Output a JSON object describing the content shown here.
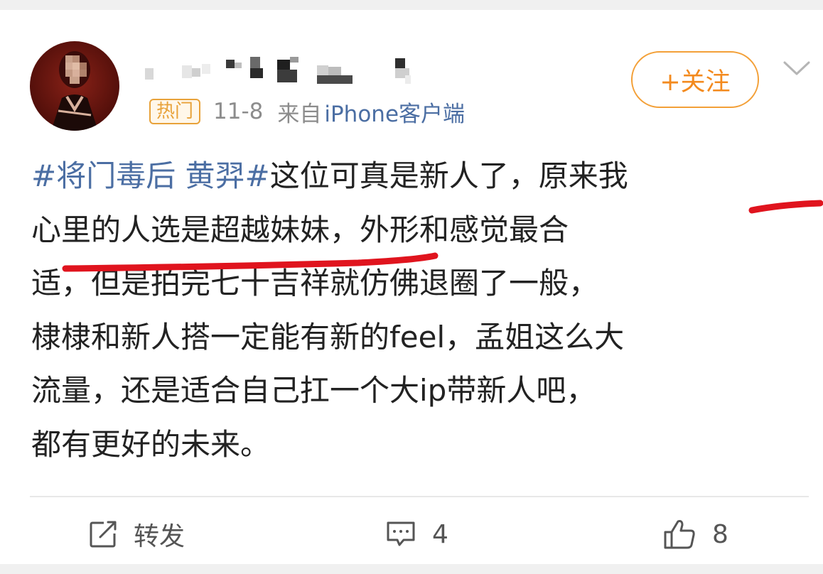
{
  "post": {
    "hot_badge": "热门",
    "date": "11-8",
    "source_prefix": "来自",
    "source": "iPhone客户端",
    "follow_label": "+关注",
    "content": {
      "topic": "#将门毒后 黄羿#",
      "line1_rest": "这位可真是新人了，原来我",
      "line2": "心里的人选是超越妹妹，外形和感觉最合",
      "line3": "适，但是拍完七十吉祥就仿佛退圈了一般，",
      "line4": "棣棣和新人搭一定能有新的feel，孟姐这么大",
      "line5": "流量，还是适合自己扛一个大ip带新人吧，",
      "line6": "都有更好的未来。"
    }
  },
  "actions": {
    "repost_label": "转发",
    "comment_count": "4",
    "like_count": "8"
  },
  "colors": {
    "link_blue": "#4b6ea3",
    "accent_orange": "#f38a1e",
    "annotation_red": "#e0141e"
  },
  "icons": {
    "repost": "repost-icon",
    "comment": "comment-icon",
    "like": "thumbs-up-icon",
    "menu": "chevron-down-icon"
  }
}
